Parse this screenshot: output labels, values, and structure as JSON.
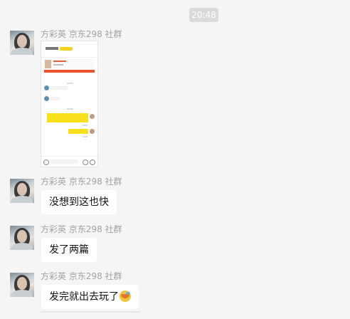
{
  "time_badge": "20:48",
  "messages": [
    {
      "sender": "方彩英 京东298 社群",
      "type": "image",
      "image_alt": "chat screenshot"
    },
    {
      "sender": "方彩英 京东298 社群",
      "type": "text",
      "text": "没想到这也快"
    },
    {
      "sender": "方彩英 京东298 社群",
      "type": "text",
      "text": "发了两篇"
    },
    {
      "sender": "方彩英 京东298 社群",
      "type": "text",
      "text": "发完就出去玩了",
      "emoji": "laughing-tears-emoji"
    }
  ],
  "colors": {
    "background": "#f5f5f5",
    "bubble": "#ffffff",
    "sender_text": "#a2a2a2",
    "time_badge": "#dadada"
  }
}
